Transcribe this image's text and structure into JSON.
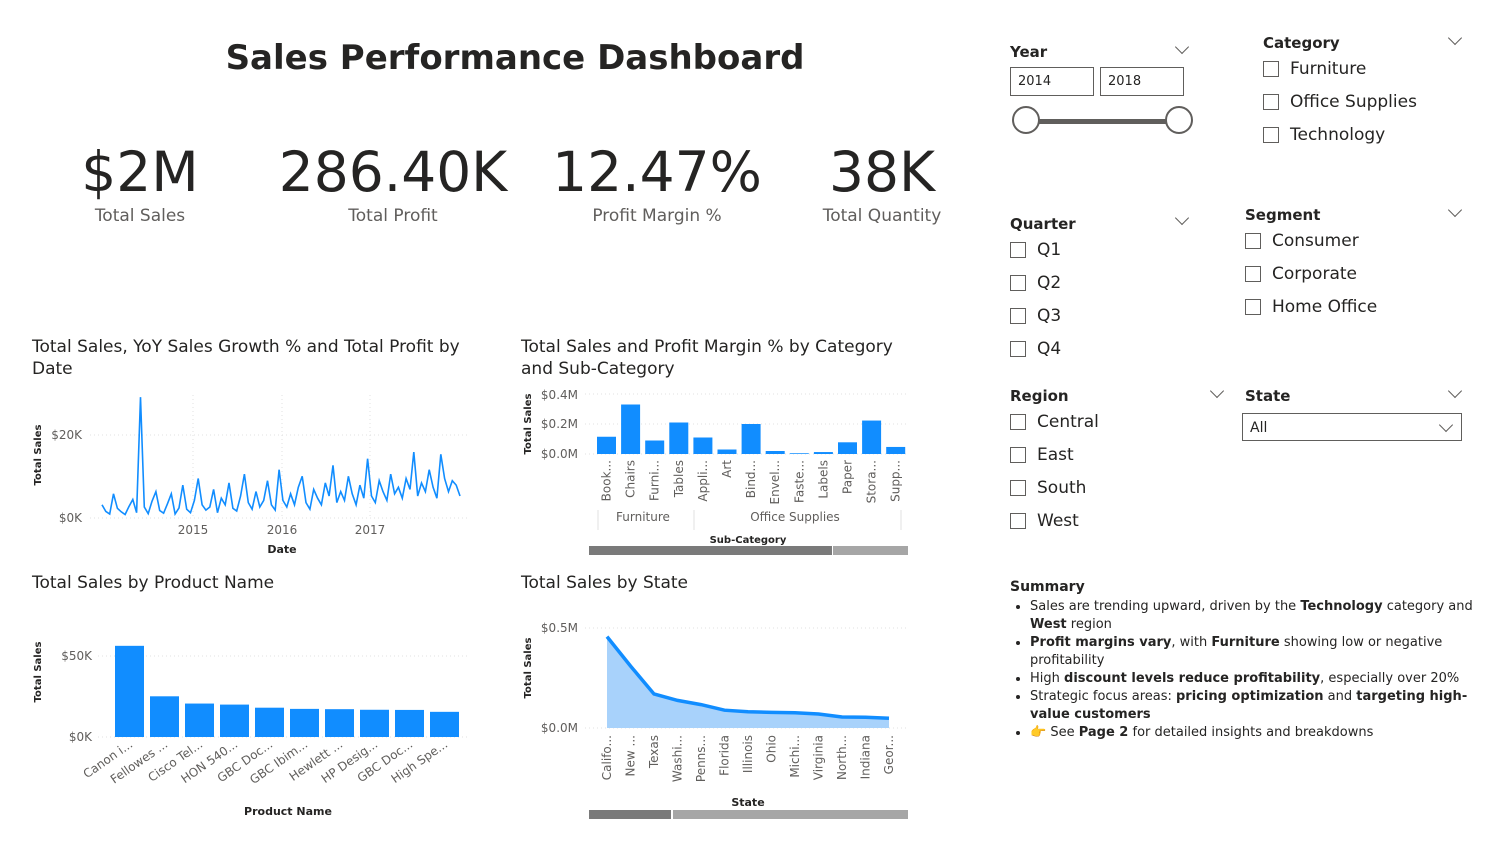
{
  "title": "Sales Performance Dashboard",
  "kpis": [
    {
      "value": "$2M",
      "label": "Total Sales"
    },
    {
      "value": "286.40K",
      "label": "Total Profit"
    },
    {
      "value": "12.47%",
      "label": "Profit Margin %"
    },
    {
      "value": "38K",
      "label": "Total Quantity"
    }
  ],
  "filters": {
    "year": {
      "title": "Year",
      "from": "2014",
      "to": "2018",
      "range": [
        2014,
        2018
      ],
      "selected": [
        2014,
        2018
      ]
    },
    "category": {
      "title": "Category",
      "options": [
        "Furniture",
        "Office Supplies",
        "Technology"
      ]
    },
    "quarter": {
      "title": "Quarter",
      "options": [
        "Q1",
        "Q2",
        "Q3",
        "Q4"
      ]
    },
    "segment": {
      "title": "Segment",
      "options": [
        "Consumer",
        "Corporate",
        "Home Office"
      ]
    },
    "region": {
      "title": "Region",
      "options": [
        "Central",
        "East",
        "South",
        "West"
      ]
    },
    "state": {
      "title": "State",
      "selected": "All"
    }
  },
  "summary": {
    "title": "Summary",
    "items": [
      {
        "pre": "Sales are trending upward, driven by the ",
        "b1": "Technology",
        "mid": " category and ",
        "b2": "West",
        "post": " region"
      },
      {
        "pre": "",
        "b1": "Profit margins vary",
        "mid": ", with ",
        "b2": "Furniture",
        "post": " showing low or negative profitability"
      },
      {
        "pre": "High ",
        "b1": "discount levels reduce profitability",
        "mid": ", especially over 20%",
        "b2": "",
        "post": ""
      },
      {
        "pre": "Strategic focus areas: ",
        "b1": "pricing optimization",
        "mid": " and ",
        "b2": "targeting high-value customers",
        "post": ""
      },
      {
        "pre": "👉 See ",
        "b1": "Page 2",
        "mid": " for detailed insights and breakdowns",
        "b2": "",
        "post": ""
      }
    ]
  },
  "colors": {
    "bar": "#118dff",
    "area": "#a8d2fb",
    "scroll_dark": "#7a7a7a",
    "scroll_light": "#a6a6a6"
  },
  "chart_data": [
    {
      "id": "sales_by_date",
      "type": "line",
      "title": "Total Sales, YoY Sales Growth % and Total Profit by Date",
      "xlabel": "Date",
      "ylabel": "Total Sales",
      "x_ticks": [
        "2015",
        "2016",
        "2017"
      ],
      "y_ticks": [
        "$0K",
        "$20K"
      ],
      "x_range": [
        2014.0,
        2018.0
      ],
      "ylim": [
        0,
        28000
      ],
      "series": [
        {
          "values": [
            3000,
            1500,
            900,
            5500,
            2200,
            1400,
            800,
            2600,
            4200,
            1200,
            27500,
            2500,
            1000,
            3800,
            6000,
            1700,
            1100,
            3200,
            5500,
            900,
            2300,
            7500,
            2000,
            1200,
            4000,
            9000,
            3000,
            1800,
            2500,
            6500,
            1200,
            4500,
            3000,
            8000,
            2200,
            1600,
            5000,
            10000,
            3500,
            2000,
            6000,
            2500,
            4000,
            8500,
            3000,
            1800,
            11000,
            4000,
            2500,
            5500,
            3000,
            7000,
            9500,
            3500,
            2000,
            6500,
            4500,
            3000,
            8000,
            5000,
            12000,
            3500,
            6000,
            4000,
            9500,
            5500,
            3000,
            7500,
            4500,
            13500,
            5000,
            3500,
            8500,
            6000,
            4000,
            10000,
            5500,
            7000,
            4500,
            9000,
            6500,
            15000,
            5000,
            8000,
            6000,
            11000,
            7000,
            4500,
            14500,
            9000,
            6000,
            8500,
            7500,
            5000
          ]
        }
      ]
    },
    {
      "id": "sales_by_subcategory",
      "type": "bar",
      "title": "Total Sales and Profit Margin % by Category and Sub-Category",
      "xlabel": "Sub-Category",
      "ylabel": "Total Sales",
      "y_ticks": [
        "$0.0M",
        "$0.2M",
        "$0.4M"
      ],
      "ylim": [
        0,
        0.4
      ],
      "groups": [
        {
          "name": "Furniture",
          "count": 4
        },
        {
          "name": "Office Supplies",
          "count": 9
        }
      ],
      "categories": [
        "Book...",
        "Chairs",
        "Furni...",
        "Tables",
        "Appli...",
        "Art",
        "Bind...",
        "Envel...",
        "Faste...",
        "Labels",
        "Paper",
        "Stora...",
        "Supp..."
      ],
      "values": [
        0.115,
        0.33,
        0.09,
        0.21,
        0.11,
        0.03,
        0.2,
        0.02,
        0.005,
        0.013,
        0.078,
        0.223,
        0.047
      ]
    },
    {
      "id": "sales_by_product",
      "type": "bar",
      "title": "Total Sales by Product Name",
      "xlabel": "Product Name",
      "ylabel": "Total Sales",
      "y_ticks": [
        "$0K",
        "$50K"
      ],
      "ylim": [
        0,
        75000
      ],
      "categories": [
        "Canon i...",
        "Fellowes ...",
        "Cisco Tel...",
        "HON 540...",
        "GBC Doc...",
        "GBC Ibim...",
        "Hewlett ...",
        "HP Desig...",
        "GBC Doc...",
        "High Spe..."
      ],
      "values": [
        61600,
        27500,
        22600,
        21900,
        19800,
        19000,
        18800,
        18400,
        18300,
        17000
      ]
    },
    {
      "id": "sales_by_state",
      "type": "area",
      "title": "Total Sales by State",
      "xlabel": "State",
      "ylabel": "Total Sales",
      "y_ticks": [
        "$0.0M",
        "$0.5M"
      ],
      "ylim": [
        0,
        0.5
      ],
      "categories": [
        "Califo...",
        "New ...",
        "Texas",
        "Washi...",
        "Penns...",
        "Florida",
        "Illinois",
        "Ohio",
        "Michi...",
        "Virginia",
        "North...",
        "Indiana",
        "Geor..."
      ],
      "values": [
        0.457,
        0.31,
        0.17,
        0.138,
        0.117,
        0.089,
        0.081,
        0.078,
        0.076,
        0.07,
        0.055,
        0.054,
        0.049
      ]
    }
  ]
}
